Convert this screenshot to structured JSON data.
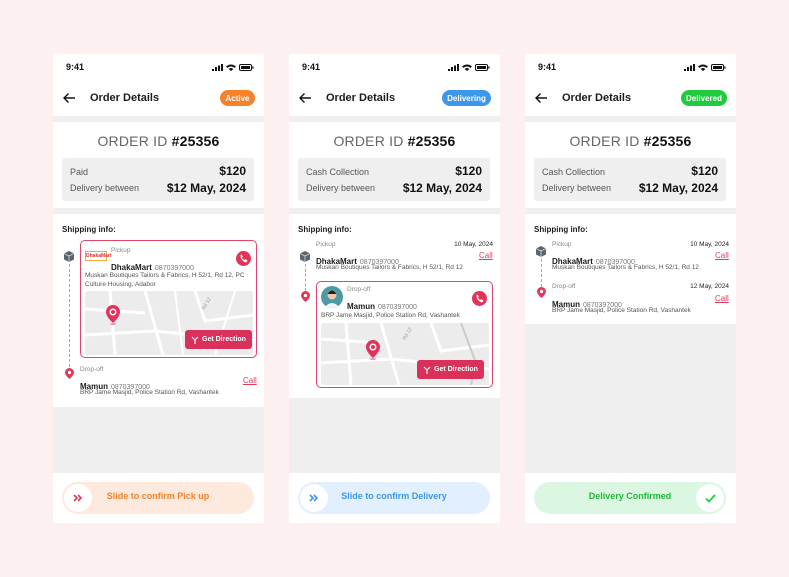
{
  "colors": {
    "active": "#f6822a",
    "delivering": "#3d97ea",
    "delivered": "#1fcc3d",
    "accent": "#e2335a"
  },
  "screens": [
    {
      "time": "9:41",
      "title": "Order Details",
      "badge": "Active",
      "order_label": "ORDER ID",
      "order_id": "#25356",
      "pay_label": "Paid",
      "pay_value": "$120",
      "delivery_label": "Delivery between",
      "delivery_value": "$12 May, 2024",
      "shipping_label": "Shipping info:",
      "pickup_label": "Pickup",
      "pickup_store_logo": "DhakaMart",
      "pickup_name": "DhakaMart",
      "pickup_phone": "0870397000",
      "pickup_address": "Muskan Boutiques Tailors & Fabrics, H 52/1, Rd 12, PC Culture Housing, Adabor",
      "map_street": "Rd 12",
      "direction_label": "Get Direction",
      "dropoff_label": "Drop-off",
      "dropoff_name": "Mamun",
      "dropoff_phone": "0870397000",
      "dropoff_address": "BRP Jame Masjid, Police Station Rd, Vashantek",
      "call_label": "Call",
      "slide_label": "Slide to confirm Pick up"
    },
    {
      "time": "9:41",
      "title": "Order Details",
      "badge": "Delivering",
      "order_label": "ORDER ID",
      "order_id": "#25356",
      "pay_label": "Cash Collection",
      "pay_value": "$120",
      "delivery_label": "Delivery between",
      "delivery_value": "$12 May, 2024",
      "shipping_label": "Shipping info:",
      "pickup_label": "Pickup",
      "pickup_date": "10 May, 2024",
      "pickup_name": "DhakaMart",
      "pickup_phone": "0870397000",
      "pickup_address": "Muskan Boutiques Tailors & Fabrics, H 52/1, Rd 12",
      "call_label": "Call",
      "dropoff_label": "Drop-off",
      "dropoff_name": "Mamun",
      "dropoff_phone": "0870397000",
      "dropoff_address": "BRP Jame Masjid, Police Station Rd, Vashantek",
      "map_street": "Rd 12",
      "direction_label": "Get Direction",
      "slide_label": "Slide to confirm Delivery"
    },
    {
      "time": "9:41",
      "title": "Order Details",
      "badge": "Delivered",
      "order_label": "ORDER ID",
      "order_id": "#25356",
      "pay_label": "Cash Collection",
      "pay_value": "$120",
      "delivery_label": "Delivery between",
      "delivery_value": "$12 May, 2024",
      "shipping_label": "Shipping info:",
      "pickup_label": "Pickup",
      "pickup_date": "10 May, 2024",
      "pickup_name": "DhakaMart",
      "pickup_phone": "0870397000",
      "pickup_address": "Muskan Boutiques Tailors & Fabrics, H 52/1, Rd 12",
      "call_label": "Call",
      "dropoff_label": "Drop-off",
      "dropoff_date": "12 May, 2024",
      "dropoff_name": "Mamun",
      "dropoff_phone": "0870397000",
      "dropoff_address": "BRP Jame Masjid, Police Station Rd, Vashantek",
      "slide_label": "Delivery Confirmed"
    }
  ]
}
